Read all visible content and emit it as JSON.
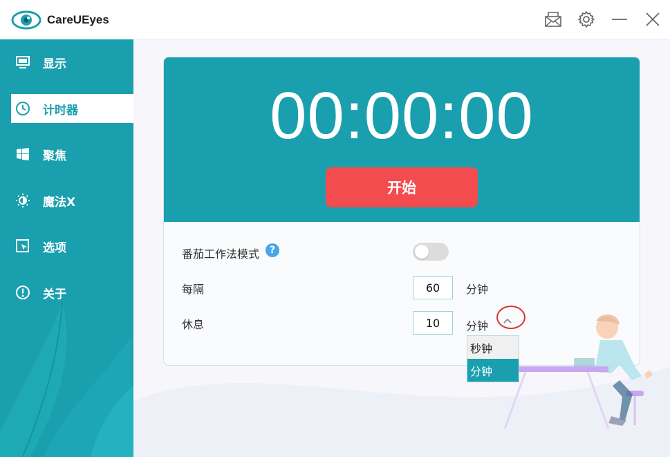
{
  "app": {
    "title": "CareUEyes"
  },
  "titlebar": {
    "icons": [
      "mail-icon",
      "gear-icon",
      "minimize-icon",
      "close-icon"
    ]
  },
  "sidebar": {
    "items": [
      {
        "label": "显示",
        "icon": "monitor-icon",
        "active": false
      },
      {
        "label": "计时器",
        "icon": "clock-icon",
        "active": true
      },
      {
        "label": "聚焦",
        "icon": "windows-icon",
        "active": false
      },
      {
        "label": "魔法X",
        "icon": "sun-icon",
        "active": false
      },
      {
        "label": "选项",
        "icon": "cursor-box-icon",
        "active": false
      },
      {
        "label": "关于",
        "icon": "info-icon",
        "active": false
      }
    ]
  },
  "timer": {
    "display": "00:00:00",
    "start_label": "开始"
  },
  "settings": {
    "pomodoro_label": "番茄工作法模式",
    "help_glyph": "?",
    "pomodoro_enabled": false,
    "interval_label": "每隔",
    "interval_value": "60",
    "interval_unit": "分钟",
    "rest_label": "休息",
    "rest_value": "10",
    "rest_unit": "分钟"
  },
  "dropdown": {
    "options": [
      "秒钟",
      "分钟"
    ],
    "selected": "分钟"
  },
  "colors": {
    "accent": "#1a9fae",
    "start_button": "#f24c4e",
    "highlight_circle": "#d8312f"
  }
}
